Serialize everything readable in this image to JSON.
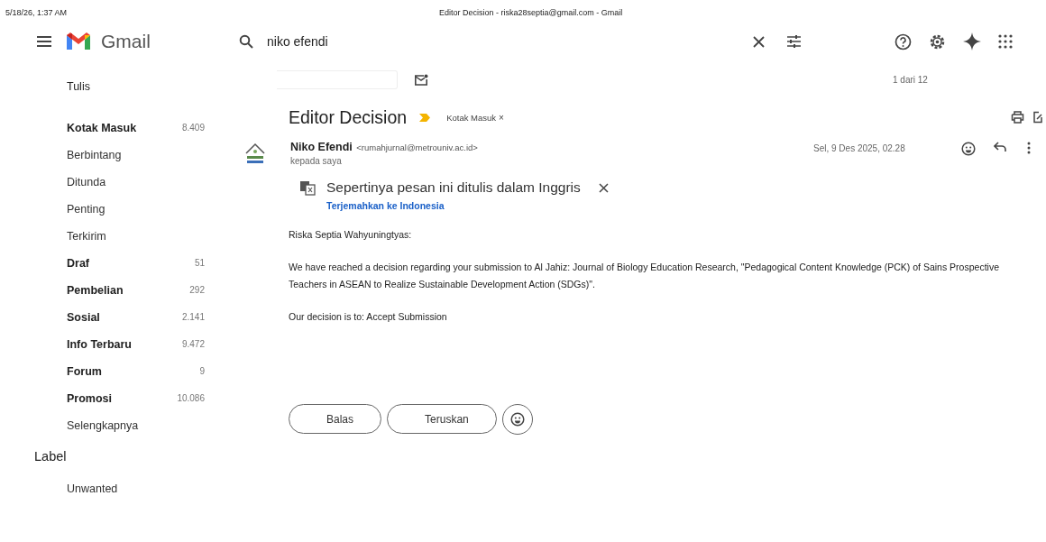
{
  "print_header": {
    "datetime": "5/18/26, 1:37 AM",
    "page_title": "Editor Decision - riska28septia@gmail.com - Gmail"
  },
  "app": {
    "name": "Gmail"
  },
  "search": {
    "value": "niko efendi"
  },
  "compose": {
    "label": "Tulis"
  },
  "sidebar": {
    "items": [
      {
        "label": "Kotak Masuk",
        "count": "8.409",
        "unread": true
      },
      {
        "label": "Berbintang",
        "unread": false
      },
      {
        "label": "Ditunda",
        "unread": false
      },
      {
        "label": "Penting",
        "unread": false
      },
      {
        "label": "Terkirim",
        "unread": false
      },
      {
        "label": "Draf",
        "count": "51",
        "unread": true
      },
      {
        "label": "Pembelian",
        "count": "292",
        "unread": true
      },
      {
        "label": "Sosial",
        "count": "2.141",
        "unread": true
      },
      {
        "label": "Info Terbaru",
        "count": "9.472",
        "unread": true
      },
      {
        "label": "Forum",
        "count": "9",
        "unread": true
      },
      {
        "label": "Promosi",
        "count": "10.086",
        "unread": true
      },
      {
        "label": "Selengkapnya",
        "unread": false
      }
    ],
    "labels_heading": "Label",
    "labels": [
      {
        "label": "Unwanted",
        "unread": false
      }
    ]
  },
  "pager": "1 dari 12",
  "message": {
    "subject": "Editor Decision",
    "label_chip": "Kotak Masuk",
    "label_chip_close": "×",
    "sender_name": "Niko Efendi",
    "sender_email": "<rumahjurnal@metrouniv.ac.id>",
    "recipient": "kepada saya",
    "date": "Sel, 9 Des 2025, 02.28",
    "translate_notice": "Sepertinya pesan ini ditulis dalam Inggris",
    "translate_link": "Terjemahkan ke Indonesia",
    "body": [
      "Riska Septia Wahyuningtyas:",
      "We have reached a decision regarding your submission to Al Jahiz: Journal of Biology Education Research, \"Pedagogical Content Knowledge (PCK) of Sains Prospective Teachers in ASEAN to Realize Sustainable Development Action (SDGs)\".",
      "Our decision is to: Accept Submission"
    ]
  },
  "actions": [
    "Balas",
    "Teruskan"
  ]
}
